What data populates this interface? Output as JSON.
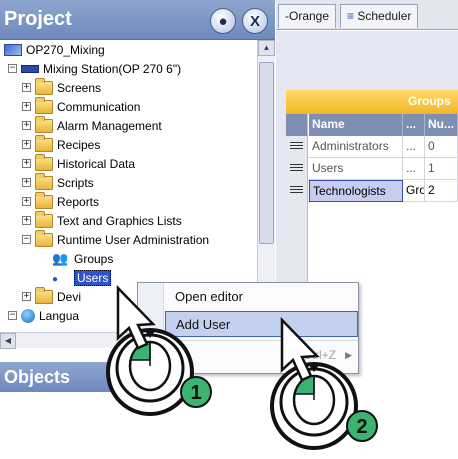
{
  "project_panel": {
    "title": "Project",
    "pin_glyph": "●",
    "close_glyph": "X",
    "objects_title": "Objects",
    "tree": [
      {
        "label": "OP270_Mixing",
        "icon": "project-icon",
        "expander": ""
      },
      {
        "label": "Mixing Station(OP 270 6\")",
        "icon": "station-icon",
        "expander": "−"
      },
      {
        "label": "Screens",
        "icon": "folder-icon",
        "expander": "+"
      },
      {
        "label": "Communication",
        "icon": "folder-icon",
        "expander": "+"
      },
      {
        "label": "Alarm Management",
        "icon": "folder-icon",
        "expander": "+"
      },
      {
        "label": "Recipes",
        "icon": "folder-icon",
        "expander": "+"
      },
      {
        "label": "Historical Data",
        "icon": "folder-icon",
        "expander": "+"
      },
      {
        "label": "Scripts",
        "icon": "folder-icon",
        "expander": "+"
      },
      {
        "label": "Reports",
        "icon": "folder-icon",
        "expander": "+"
      },
      {
        "label": "Text and Graphics Lists",
        "icon": "folder-icon",
        "expander": "+"
      },
      {
        "label": "Runtime User Administration",
        "icon": "folder-icon",
        "expander": "−"
      },
      {
        "label": "Groups",
        "icon": "groups-icon",
        "expander": ""
      },
      {
        "label": "Users",
        "icon": "user-icon",
        "expander": ""
      },
      {
        "label": "Devi",
        "icon": "folder-icon",
        "expander": "+"
      },
      {
        "label": "Langua",
        "icon": "lang-icon",
        "expander": "−"
      }
    ]
  },
  "editor": {
    "tabs": [
      "-Orange",
      "Scheduler"
    ],
    "groups_band": "Groups",
    "columns": [
      "Name",
      "...",
      "Nu..."
    ],
    "rows": [
      {
        "name": "Administrators",
        "display": "...",
        "number": "0"
      },
      {
        "name": "Users",
        "display": "...",
        "number": "1"
      },
      {
        "name": "Technologists",
        "display": "Gro",
        "number": "2"
      }
    ]
  },
  "context_menu": {
    "items": [
      {
        "label": "Open editor"
      },
      {
        "label": "Add User"
      },
      {
        "label": "",
        "shortcut": "Ctrl+Z",
        "dim": true
      }
    ]
  },
  "callouts": {
    "step1": "1",
    "step2": "2"
  },
  "colors": {
    "header_blue": "#7f93c4",
    "accent_yellow": "#f6c63a",
    "selection_blue": "#2f54c9",
    "callout_green": "#3cb371",
    "menu_highlight": "#c3d0ee"
  }
}
